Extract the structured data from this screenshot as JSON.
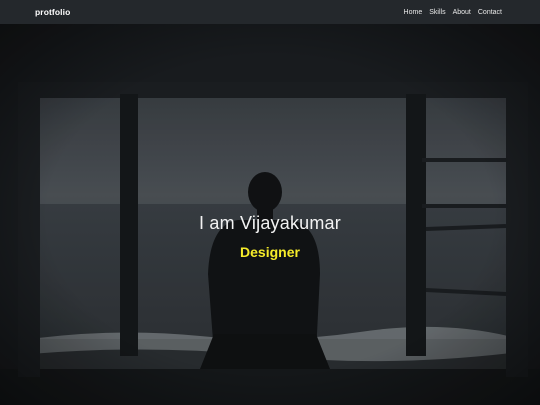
{
  "navbar": {
    "brand": "protfolio",
    "links": [
      {
        "label": "Home"
      },
      {
        "label": "Skills"
      },
      {
        "label": "About"
      },
      {
        "label": "Contact"
      }
    ]
  },
  "hero": {
    "title": "I am Vijayakumar",
    "role": "Designer",
    "role_color": "#f6ec2a",
    "background_image": "person-silhouette-at-window-overlooking-sea"
  }
}
